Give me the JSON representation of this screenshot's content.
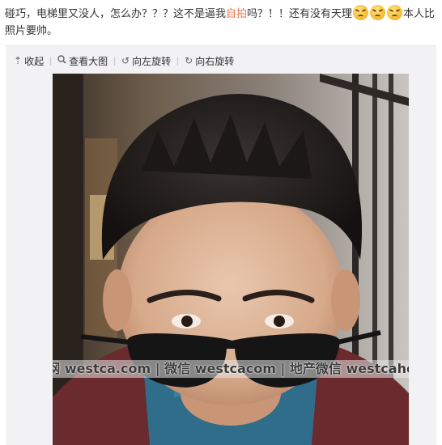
{
  "post": {
    "text_before": "碰巧，电梯里又没人，怎么办？？？这不是逼我",
    "highlight": "自拍",
    "text_after": "吗？！！还有没有天理",
    "text_end": "本人比照片要帅。",
    "emoji_icon": "angry-face-icon"
  },
  "toolbar": {
    "collapse": "收起",
    "view_large": "查看大图",
    "rotate_left": "向左旋转",
    "rotate_right": "向右旋转"
  },
  "watermark": "加西网 westca.com | 微信 westcacom | 地产微信 westcahouse",
  "colors": {
    "highlight": "#eb7350",
    "media_background": "#f2f2f5"
  }
}
